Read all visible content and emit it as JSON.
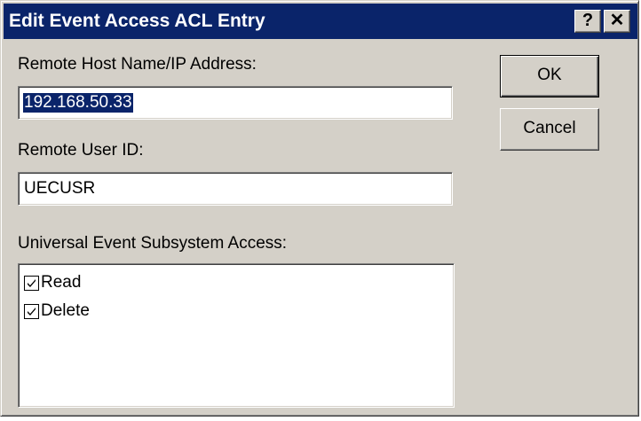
{
  "window": {
    "title": "Edit Event Access ACL Entry",
    "help_button": "?",
    "close_button": "✕"
  },
  "form": {
    "host_label": "Remote Host Name/IP Address:",
    "host_value": "192.168.50.33",
    "user_label": "Remote User ID:",
    "user_value": "UECUSR",
    "access_label": "Universal Event Subsystem Access:",
    "access_items": [
      {
        "label": "Read",
        "checked": true
      },
      {
        "label": "Delete",
        "checked": true
      }
    ]
  },
  "buttons": {
    "ok_label": "OK",
    "cancel_label": "Cancel"
  },
  "icons": {
    "help": "help-icon",
    "close": "close-icon",
    "check": "checkmark-icon"
  },
  "colors": {
    "titlebar": "#0a246a",
    "face": "#d4d0c8",
    "selection": "#0a246a"
  }
}
